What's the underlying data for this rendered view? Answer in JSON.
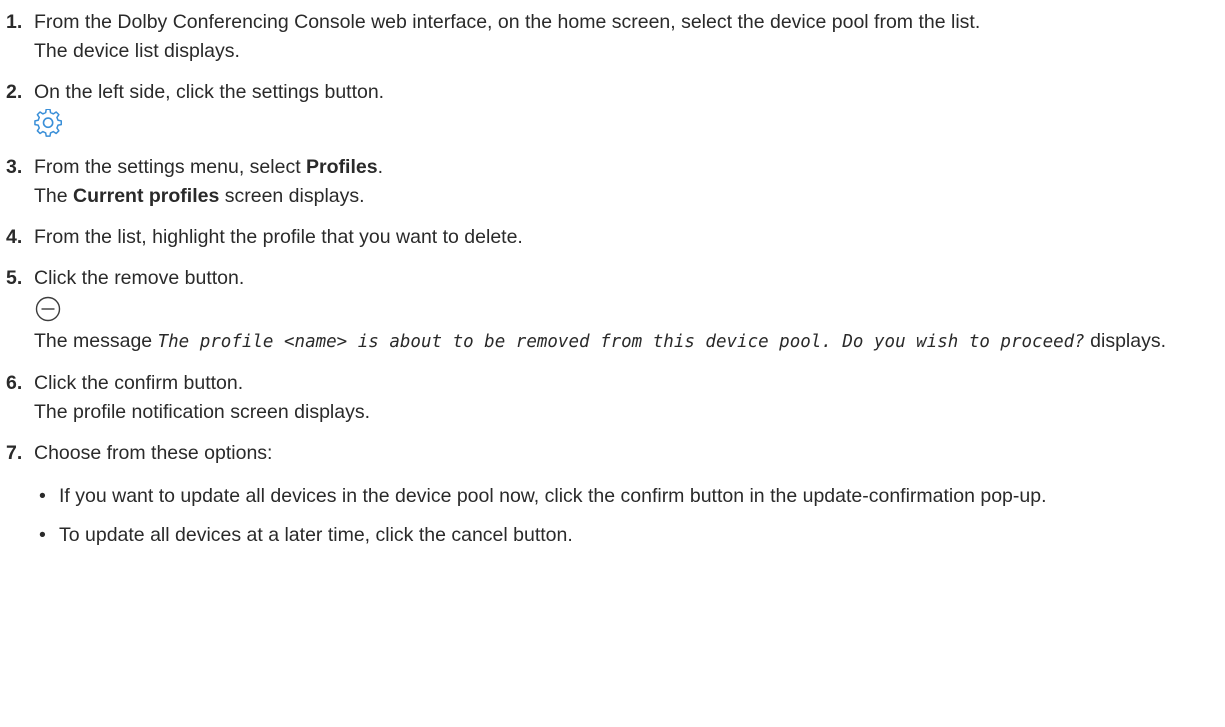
{
  "steps": [
    {
      "num": "1.",
      "text": "From the Dolby Conferencing Console web interface, on the home screen, select the device pool from the list.",
      "result": "The device list displays."
    },
    {
      "num": "2.",
      "text": "On the left side, click the settings button.",
      "icon": "gear-icon"
    },
    {
      "num": "3.",
      "pre": "From the settings menu, select ",
      "bold": "Profiles",
      "post": ".",
      "result_pre": "The ",
      "result_bold": "Current profiles",
      "result_post": " screen displays."
    },
    {
      "num": "4.",
      "text": "From the list, highlight the profile that you want to delete."
    },
    {
      "num": "5.",
      "text": "Click the remove button.",
      "icon": "minus-circle-icon",
      "msg_pre": "The message ",
      "msg_mono": "The profile <name> is about to be removed from this device pool. Do you wish to proceed?",
      "msg_post": " displays."
    },
    {
      "num": "6.",
      "text": "Click the confirm button.",
      "result": "The profile notification screen displays."
    },
    {
      "num": "7.",
      "text": "Choose from these options:",
      "bullet_mark": "•",
      "options": [
        "If you want to update all devices in the device pool now, click the confirm button in the update-confirmation pop-up.",
        "To update all devices at a later time, click the cancel button."
      ]
    }
  ],
  "colors": {
    "text": "#2a2a2a",
    "gear_icon": "#3a8fd8",
    "remove_icon": "#3c3c3c"
  }
}
